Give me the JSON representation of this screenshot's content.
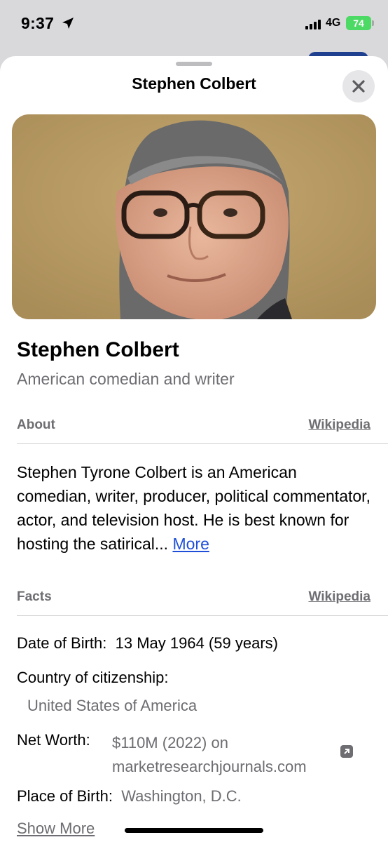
{
  "status_bar": {
    "time": "9:37",
    "network": "4G",
    "battery": "74"
  },
  "sheet": {
    "title": "Stephen Colbert",
    "close_icon": "close-icon"
  },
  "person": {
    "name": "Stephen Colbert",
    "description": "American comedian and writer"
  },
  "about": {
    "header": "About",
    "source": "Wikipedia",
    "text": "Stephen Tyrone Colbert is an American comedian, writer, producer, political commentator, actor, and television host. He is best known for hosting the satirical...",
    "more_label": "More"
  },
  "facts": {
    "header": "Facts",
    "source": "Wikipedia",
    "items": [
      {
        "label": "Date of Birth:",
        "value": "13 May 1964 (59 years)"
      },
      {
        "label": "Country of citizenship:",
        "value": "United States of America"
      },
      {
        "label": "Net Worth:",
        "value_line1": "$110M (2022) on",
        "value_line2": "marketresearchjournals.com"
      },
      {
        "label": "Place of Birth:",
        "value": "Washington, D.C."
      }
    ],
    "show_more_label": "Show More"
  },
  "colors": {
    "link": "#1f4ed8",
    "secondary_text": "#6d6d72",
    "battery": "#4cd964"
  }
}
